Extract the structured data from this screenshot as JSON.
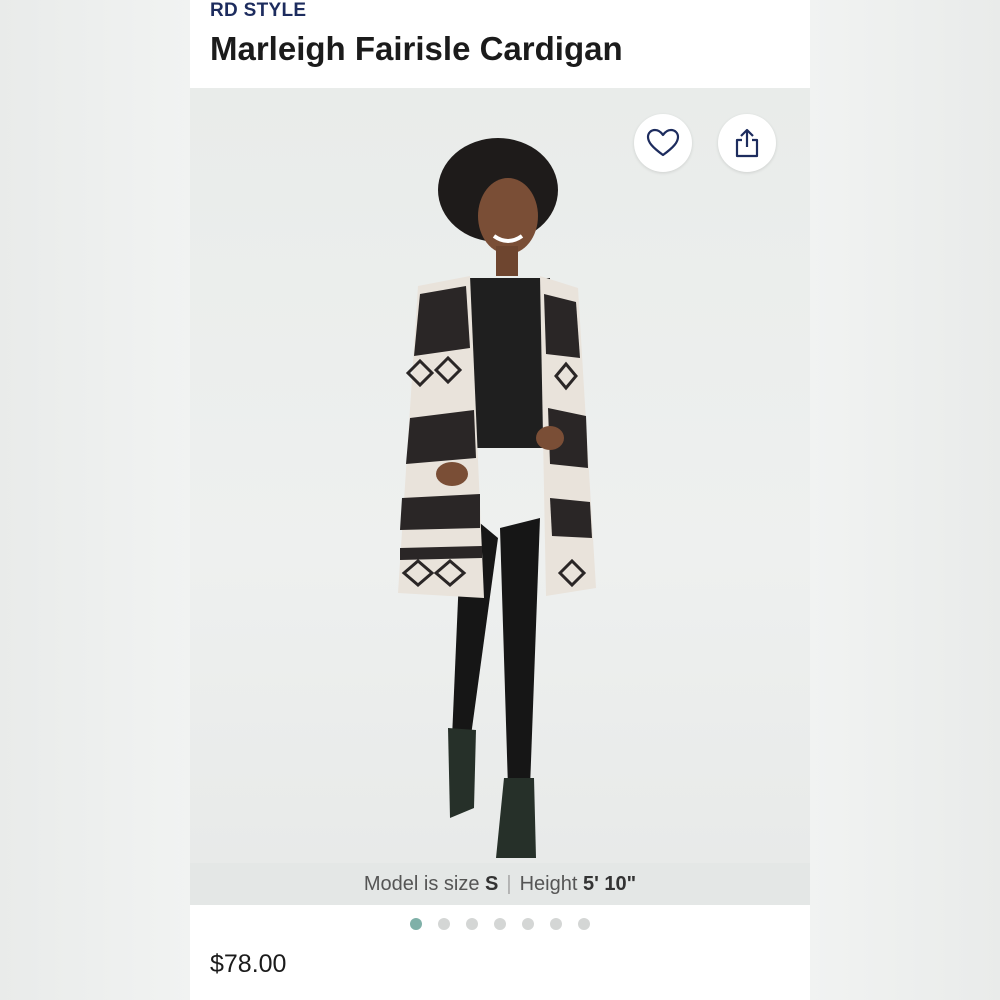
{
  "product": {
    "brand": "RD STYLE",
    "title": "Marleigh Fairisle Cardigan",
    "price": "$78.00"
  },
  "caption": {
    "size_label": "Model is size",
    "size_value": "S",
    "height_label": "Height",
    "height_value": "5' 10\""
  },
  "actions": {
    "favorite_icon": "heart-icon",
    "share_icon": "share-icon"
  },
  "carousel": {
    "total": 7,
    "active_index": 0
  },
  "colors": {
    "brand": "#1d2c5e",
    "active_dot": "#7fb0a8",
    "inactive_dot": "#d4d6d5"
  }
}
